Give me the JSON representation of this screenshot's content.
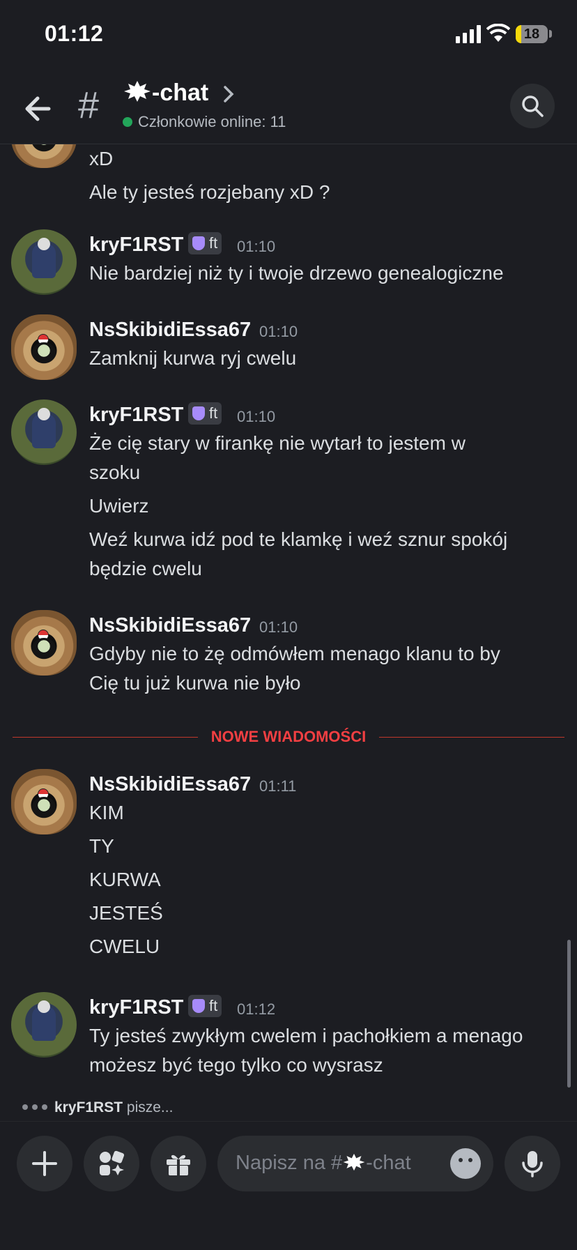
{
  "status_bar": {
    "time": "01:12",
    "battery": "18"
  },
  "header": {
    "channel_name": "-chat",
    "online_text": "Członkowie online: 11"
  },
  "messages": [
    {
      "author": "",
      "tag": "",
      "time": "",
      "lines": [
        "xD",
        "Ale ty jesteś rozjebany xD ?"
      ]
    },
    {
      "author": "kryF1RST",
      "tag": "ft",
      "time": "01:10",
      "lines": [
        "Nie bardziej niż ty i twoje drzewo genealogiczne"
      ]
    },
    {
      "author": "NsSkibidiEssa67",
      "tag": "",
      "time": "01:10",
      "lines": [
        "Zamknij kurwa ryj cwelu"
      ]
    },
    {
      "author": "kryF1RST",
      "tag": "ft",
      "time": "01:10",
      "lines": [
        "Że cię stary w firankę nie wytarł to jestem w",
        "szoku",
        "Uwierz",
        "Weź kurwa idź pod te klamkę i weź sznur spokój",
        "będzie cwelu"
      ]
    },
    {
      "author": "NsSkibidiEssa67",
      "tag": "",
      "time": "01:10",
      "lines": [
        "Gdyby nie to żę odmówłem menago klanu to by",
        "Cię tu już kurwa nie było"
      ]
    },
    {
      "author": "NsSkibidiEssa67",
      "tag": "",
      "time": "01:11",
      "lines": [
        "KIM",
        "TY",
        "KURWA",
        "JESTEŚ",
        "CWELU"
      ]
    },
    {
      "author": "kryF1RST",
      "tag": "ft",
      "time": "01:12",
      "lines": [
        "Ty jesteś zwykłym cwelem i pachołkiem a menago",
        "możesz być tego tylko co wysrasz"
      ]
    }
  ],
  "new_messages_label": "NOWE WIADOMOŚCI",
  "typing": {
    "user": "kryF1RST",
    "text": "pisze..."
  },
  "composer": {
    "placeholder_prefix": "Napisz na #",
    "placeholder_suffix": "-chat"
  }
}
